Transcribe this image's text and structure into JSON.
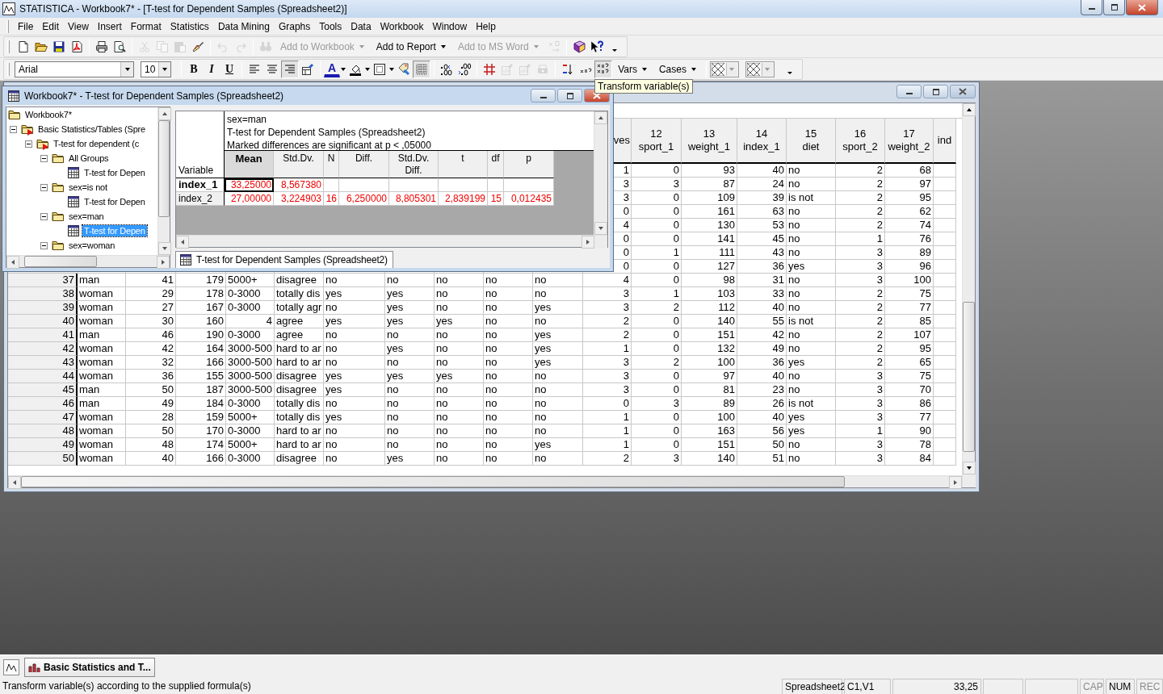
{
  "window": {
    "title": "STATISTICA - Workbook7* - [T-test for Dependent Samples (Spreadsheet2)]"
  },
  "menu": [
    {
      "label": "File"
    },
    {
      "label": "Edit"
    },
    {
      "label": "View"
    },
    {
      "label": "Insert"
    },
    {
      "label": "Format"
    },
    {
      "label": "Statistics"
    },
    {
      "label": "Data Mining"
    },
    {
      "label": "Graphs"
    },
    {
      "label": "Tools"
    },
    {
      "label": "Data"
    },
    {
      "label": "Workbook"
    },
    {
      "label": "Window"
    },
    {
      "label": "Help"
    }
  ],
  "toolbar": [
    {
      "kind": "icon",
      "disabled": false
    },
    {
      "kind": "icon",
      "disabled": false
    },
    {
      "kind": "icon",
      "disabled": false
    },
    {
      "kind": "icon",
      "disabled": false
    },
    {
      "kind": "separator"
    },
    {
      "kind": "icon",
      "disabled": false
    },
    {
      "kind": "icon",
      "disabled": false
    },
    {
      "kind": "separator"
    },
    {
      "kind": "icon",
      "disabled": true
    },
    {
      "kind": "icon",
      "disabled": true
    },
    {
      "kind": "icon",
      "disabled": true
    },
    {
      "kind": "icon",
      "disabled": false
    },
    {
      "kind": "separator"
    },
    {
      "kind": "icon",
      "disabled": true
    },
    {
      "kind": "icon",
      "disabled": true
    },
    {
      "kind": "separator"
    },
    {
      "kind": "icon",
      "disabled": true
    },
    {
      "kind": "dropdown",
      "label": "Add to Workbook",
      "disabled": true
    },
    {
      "kind": "dropdown",
      "label": "Add to Report",
      "disabled": false
    },
    {
      "kind": "dropdown",
      "label": "Add to MS Word",
      "disabled": true
    },
    {
      "kind": "icon",
      "disabled": true
    },
    {
      "kind": "separator"
    },
    {
      "kind": "icon",
      "disabled": false
    },
    {
      "kind": "icon",
      "disabled": false
    },
    {
      "kind": "icon",
      "disabled": false
    }
  ],
  "format_toolbar": [
    {
      "kind": "font-combo",
      "value": "Arial"
    },
    {
      "kind": "size-combo",
      "value": "10"
    },
    {
      "kind": "separator"
    },
    {
      "kind": "bold-button",
      "label": "B"
    },
    {
      "kind": "italic-button",
      "label": "I"
    },
    {
      "kind": "underline-button",
      "label": "U"
    },
    {
      "kind": "separator"
    },
    {
      "kind": "icon",
      "pressed": false,
      "disabled": false
    },
    {
      "kind": "icon",
      "pressed": false,
      "disabled": false
    },
    {
      "kind": "icon",
      "pressed": true,
      "disabled": false
    },
    {
      "kind": "icon",
      "pressed": false,
      "disabled": false
    },
    {
      "kind": "separator"
    },
    {
      "kind": "font-color-button",
      "label": "A"
    },
    {
      "kind": "icon",
      "pressed": false,
      "disabled": false
    },
    {
      "kind": "icon",
      "pressed": false,
      "disabled": false
    },
    {
      "kind": "icon",
      "pressed": false,
      "disabled": false
    },
    {
      "kind": "icon",
      "pressed": true,
      "disabled": false
    },
    {
      "kind": "separator"
    },
    {
      "kind": "icon",
      "pressed": false,
      "disabled": false
    },
    {
      "kind": "icon",
      "pressed": false,
      "disabled": false
    },
    {
      "kind": "separator"
    },
    {
      "kind": "icon",
      "pressed": false,
      "disabled": false
    },
    {
      "kind": "icon",
      "pressed": false,
      "disabled": true
    },
    {
      "kind": "icon",
      "pressed": false,
      "disabled": true
    },
    {
      "kind": "icon",
      "pressed": false,
      "disabled": true
    },
    {
      "kind": "separator"
    },
    {
      "kind": "icon",
      "pressed": false,
      "disabled": false
    },
    {
      "kind": "icon",
      "pressed": false,
      "disabled": false
    },
    {
      "kind": "icon",
      "pressed": true,
      "disabled": false
    },
    {
      "kind": "dropdown",
      "label": "Vars"
    },
    {
      "kind": "dropdown",
      "label": "Cases"
    },
    {
      "kind": "separator"
    },
    {
      "kind": "pattern"
    },
    {
      "kind": "pattern"
    },
    {
      "kind": "icon",
      "pressed": false,
      "disabled": false
    }
  ],
  "tooltip": "Transform variable(s)",
  "workbook": {
    "title": "Workbook7* - T-test for Dependent Samples (Spreadsheet2)",
    "tree": [
      {
        "label": "Workbook7*",
        "kind": "folder",
        "selected": false,
        "children": [
          {
            "label": "Basic Statistics/Tables (Spre",
            "kind": "analysis",
            "expanded": true,
            "selected": false,
            "children": [
              {
                "label": "T-test for dependent (c",
                "kind": "analysis",
                "expanded": true,
                "selected": false,
                "children": [
                  {
                    "label": "All Groups",
                    "kind": "folder",
                    "expanded": true,
                    "selected": false,
                    "children": [
                      {
                        "label": "T-test for Depen",
                        "kind": "sheet",
                        "selected": false
                      }
                    ]
                  },
                  {
                    "label": "sex=is not",
                    "kind": "folder",
                    "expanded": true,
                    "selected": false,
                    "children": [
                      {
                        "label": "T-test for Depen",
                        "kind": "sheet",
                        "selected": false
                      }
                    ]
                  },
                  {
                    "label": "sex=man",
                    "kind": "folder",
                    "expanded": true,
                    "selected": false,
                    "children": [
                      {
                        "label": "T-test for Depen",
                        "kind": "sheet",
                        "selected": true
                      }
                    ]
                  },
                  {
                    "label": "sex=woman",
                    "kind": "folder",
                    "expanded": true,
                    "selected": false
                  }
                ]
              }
            ]
          }
        ]
      }
    ],
    "results": {
      "lines": [
        "sex=man",
        "T-test for Dependent Samples (Spreadsheet2)",
        "Marked differences are significant at p < ,05000"
      ],
      "row_header": "Variable",
      "columns": [
        {
          "label": "Mean",
          "selected": true
        },
        {
          "label": "Std.Dv.",
          "selected": false
        },
        {
          "label": "N",
          "selected": false
        },
        {
          "label": "Diff.",
          "selected": false
        },
        {
          "label": "Std.Dv.\nDiff.",
          "selected": false
        },
        {
          "label": "t",
          "selected": false
        },
        {
          "label": "df",
          "selected": false
        },
        {
          "label": "p",
          "selected": false
        }
      ],
      "rows": [
        {
          "name": "index_1",
          "selected": true,
          "marked": true,
          "values": [
            "33,25000",
            "8,567380"
          ]
        },
        {
          "name": "index_2",
          "selected": false,
          "marked": true,
          "values": [
            "27,00000",
            "3,224903",
            "16",
            "6,250000",
            "8,805301",
            "2,839199",
            "15",
            "0,012435"
          ]
        }
      ]
    },
    "tabs": [
      {
        "label": "T-test for Dependent Samples (Spreadsheet2)",
        "selected": true
      }
    ]
  },
  "spreadsheet": {
    "columns": [
      {
        "kind": "text"
      },
      {
        "kind": "number"
      },
      {
        "kind": "number"
      },
      {
        "kind": "text"
      },
      {
        "kind": "text"
      },
      {
        "kind": "text"
      },
      {
        "kind": "text"
      },
      {
        "kind": "text"
      },
      {
        "kind": "text"
      },
      {
        "kind": "text"
      },
      {
        "kind": "number",
        "name": "ves"
      },
      {
        "kind": "number",
        "number": "12",
        "name": "sport_1"
      },
      {
        "kind": "number",
        "number": "13",
        "name": "weight_1"
      },
      {
        "kind": "number",
        "number": "14",
        "name": "index_1"
      },
      {
        "kind": "text",
        "number": "15",
        "name": "diet"
      },
      {
        "kind": "number",
        "number": "16",
        "name": "sport_2"
      },
      {
        "kind": "number",
        "number": "17",
        "name": "weight_2"
      },
      {
        "name": "ind"
      }
    ],
    "upper_rows": [
      {
        "cells": [
          "1",
          "0",
          "93",
          "40",
          "no",
          "2",
          "68"
        ]
      },
      {
        "cells": [
          "3",
          "3",
          "87",
          "24",
          "no",
          "2",
          "97"
        ]
      },
      {
        "cells": [
          "3",
          "0",
          "109",
          "39",
          "is not",
          "2",
          "95"
        ]
      },
      {
        "cells": [
          "0",
          "0",
          "161",
          "63",
          "no",
          "2",
          "62"
        ]
      },
      {
        "cells": [
          "4",
          "0",
          "130",
          "53",
          "no",
          "2",
          "74"
        ]
      },
      {
        "cells": [
          "0",
          "0",
          "141",
          "45",
          "no",
          "1",
          "76"
        ]
      },
      {
        "cells": [
          "0",
          "1",
          "111",
          "43",
          "no",
          "3",
          "89"
        ]
      },
      {
        "cells": [
          "0",
          "0",
          "127",
          "36",
          "yes",
          "3",
          "96"
        ]
      }
    ],
    "rows": [
      {
        "case": "37",
        "cells": [
          "man",
          "41",
          "179",
          "5000+",
          "disagree",
          "no",
          "no",
          "no",
          "no",
          "no",
          "4",
          "0",
          "98",
          "31",
          "no",
          "3",
          "100"
        ]
      },
      {
        "case": "38",
        "cells": [
          "woman",
          "29",
          "178",
          "0-3000",
          "totally dis",
          "yes",
          "yes",
          "no",
          "no",
          "no",
          "3",
          "1",
          "103",
          "33",
          "no",
          "2",
          "75"
        ]
      },
      {
        "case": "39",
        "cells": [
          "woman",
          "27",
          "167",
          "0-3000",
          "totally agr",
          "no",
          "yes",
          "no",
          "no",
          "yes",
          "3",
          "2",
          "112",
          "40",
          "no",
          "2",
          "77"
        ]
      },
      {
        "case": "40",
        "cells": [
          "woman",
          "30",
          "160",
          {
            "value": "4",
            "kind": "number"
          },
          "agree",
          "yes",
          "yes",
          "yes",
          "no",
          "no",
          "2",
          "0",
          "140",
          "55",
          "is not",
          "2",
          "85"
        ]
      },
      {
        "case": "41",
        "cells": [
          "man",
          "46",
          "190",
          "0-3000",
          "agree",
          "no",
          "no",
          "no",
          "no",
          "yes",
          "2",
          "0",
          "151",
          "42",
          "no",
          "2",
          "107"
        ]
      },
      {
        "case": "42",
        "cells": [
          "woman",
          "42",
          "164",
          "3000-500",
          "hard to ar",
          "no",
          "yes",
          "no",
          "no",
          "yes",
          "1",
          "0",
          "132",
          "49",
          "no",
          "2",
          "95"
        ]
      },
      {
        "case": "43",
        "cells": [
          "woman",
          "32",
          "166",
          "3000-500",
          "hard to ar",
          "no",
          "no",
          "no",
          "no",
          "yes",
          "3",
          "2",
          "100",
          "36",
          "yes",
          "2",
          "65"
        ]
      },
      {
        "case": "44",
        "cells": [
          "woman",
          "36",
          "155",
          "3000-500",
          "disagree",
          "yes",
          "yes",
          "yes",
          "no",
          "no",
          "3",
          "0",
          "97",
          "40",
          "no",
          "3",
          "75"
        ]
      },
      {
        "case": "45",
        "cells": [
          "man",
          "50",
          "187",
          "3000-500",
          "disagree",
          "yes",
          "no",
          "no",
          "no",
          "no",
          "3",
          "0",
          "81",
          "23",
          "no",
          "3",
          "70"
        ]
      },
      {
        "case": "46",
        "cells": [
          "man",
          "49",
          "184",
          "0-3000",
          "totally dis",
          "no",
          "no",
          "no",
          "no",
          "no",
          "0",
          "3",
          "89",
          "26",
          "is not",
          "3",
          "86"
        ]
      },
      {
        "case": "47",
        "cells": [
          "woman",
          "28",
          "159",
          "5000+",
          "totally dis",
          "yes",
          "no",
          "no",
          "no",
          "no",
          "1",
          "0",
          "100",
          "40",
          "yes",
          "3",
          "77"
        ]
      },
      {
        "case": "48",
        "cells": [
          "woman",
          "50",
          "170",
          "0-3000",
          "hard to ar",
          "no",
          "no",
          "no",
          "no",
          "no",
          "1",
          "0",
          "163",
          "56",
          "yes",
          "1",
          "90"
        ]
      },
      {
        "case": "49",
        "cells": [
          "woman",
          "48",
          "174",
          "5000+",
          "hard to ar",
          "no",
          "no",
          "no",
          "no",
          "yes",
          "1",
          "0",
          "151",
          "50",
          "no",
          "3",
          "78"
        ]
      },
      {
        "case": "50",
        "cells": [
          "woman",
          "40",
          "166",
          "0-3000",
          "disagree",
          "no",
          "yes",
          "no",
          "no",
          "no",
          "2",
          "3",
          "140",
          "51",
          "no",
          "3",
          "84"
        ]
      }
    ]
  },
  "taskbar": [
    {
      "label": "Basic Statistics and T..."
    }
  ],
  "status_bar": {
    "message": "Transform variable(s) according to the supplied formula(s)",
    "sheet": "Spreadsheet2",
    "cell": "C1,V1",
    "value": "33,25",
    "indicators": [
      {
        "label": "CAP",
        "on": false
      },
      {
        "label": "NUM",
        "on": true
      },
      {
        "label": "REC",
        "on": false
      }
    ]
  }
}
